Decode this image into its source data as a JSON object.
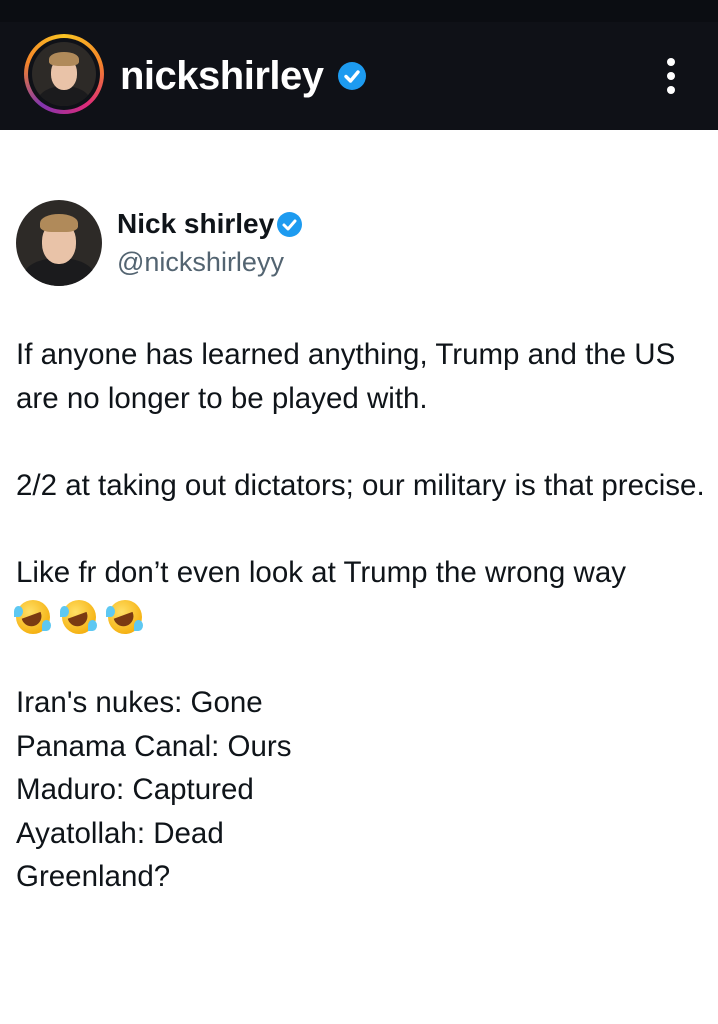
{
  "instagram_header": {
    "username": "nickshirley",
    "verified": true,
    "menu_icon": "more-vertical-icon"
  },
  "tweet": {
    "display_name": "Nick shirley",
    "handle": "@nickshirleyy",
    "verified": true,
    "paragraphs": [
      "If anyone has learned anything, Trump and the US are no longer to be played with.",
      "2/2 at taking out dictators; our military is that precise.",
      "Like fr don’t even look at Trump the wrong way"
    ],
    "emojis": [
      "rolling-on-floor-laughing-emoji",
      "rolling-on-floor-laughing-emoji",
      "rolling-on-floor-laughing-emoji"
    ],
    "list_lines": [
      "Iran's nukes: Gone",
      "Panama Canal: Ours",
      "Maduro: Captured",
      "Ayatollah: Dead",
      "Greenland?"
    ]
  },
  "colors": {
    "header_background": "#0f1117",
    "verified_blue": "#1d9bf0",
    "text_primary": "#0f1419",
    "text_secondary": "#536471"
  }
}
